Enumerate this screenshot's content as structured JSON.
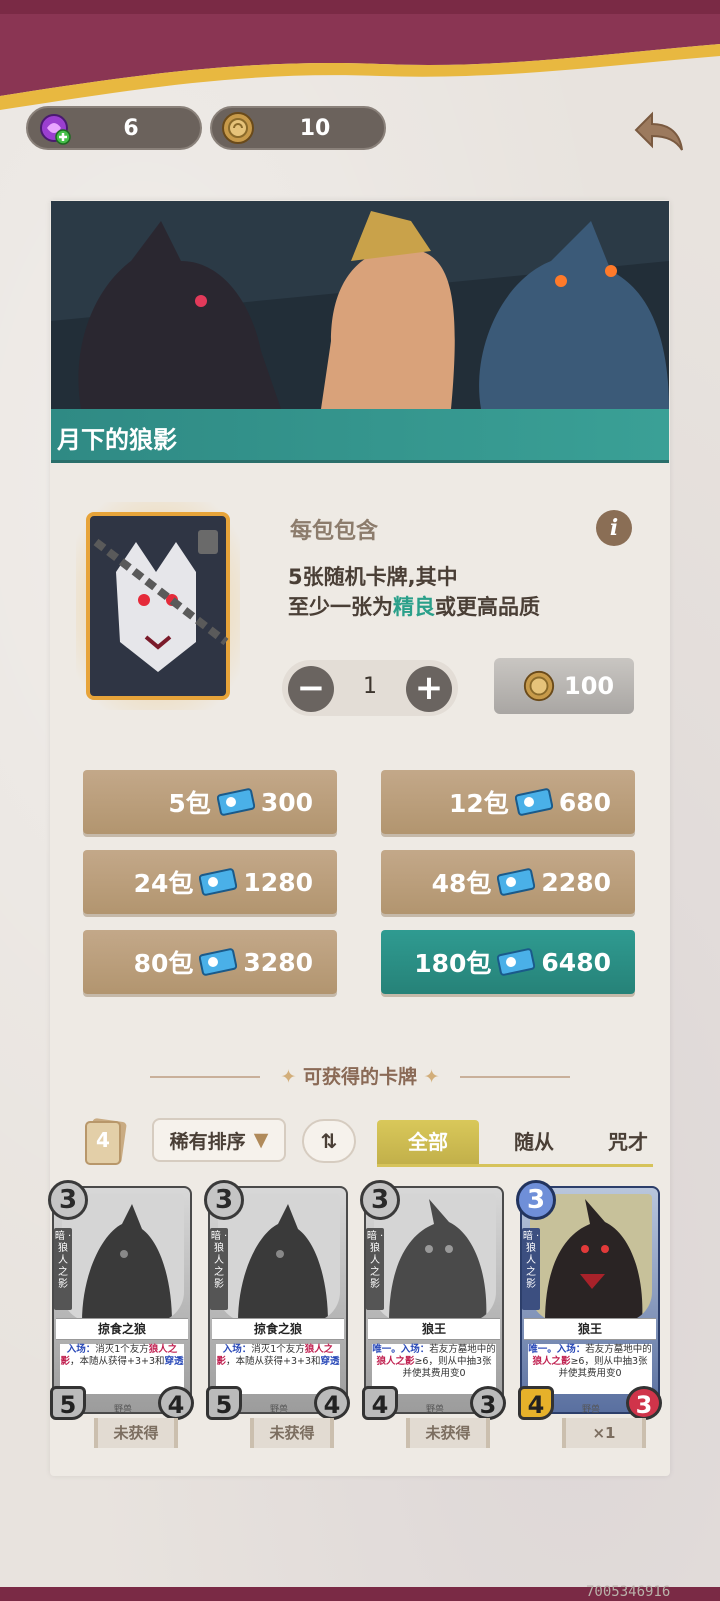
{
  "currency": {
    "essence": {
      "icon": "purple-candy-plus-icon",
      "value": "6"
    },
    "gold": {
      "icon": "gold-coin-icon",
      "value": "10"
    }
  },
  "header": {
    "back_icon": "back-arrow-icon"
  },
  "pack": {
    "title": "月下的狼影",
    "contains_label": "每包包含",
    "desc_line1": "5张随机卡牌,其中",
    "desc_line2_prefix": "至少一张为",
    "desc_line2_highlight": "精良",
    "desc_line2_suffix": "或更高品质",
    "quantity": "1",
    "price": "100"
  },
  "bulk_offers": [
    {
      "label": "5包",
      "price": "300",
      "highlight": false
    },
    {
      "label": "12包",
      "price": "680",
      "highlight": false
    },
    {
      "label": "24包",
      "price": "1280",
      "highlight": false
    },
    {
      "label": "48包",
      "price": "2280",
      "highlight": false
    },
    {
      "label": "80包",
      "price": "3280",
      "highlight": false
    },
    {
      "label": "180包",
      "price": "6480",
      "highlight": true
    }
  ],
  "cards_section": {
    "title": "可获得的卡牌",
    "count": "4",
    "sort_label": "稀有排序",
    "order_label": "⇅",
    "tabs": [
      "全部",
      "随从",
      "咒才"
    ]
  },
  "cards": [
    {
      "name": "掠食之狼",
      "cost": "3",
      "atk": "5",
      "hp": "4",
      "side": "暗 · 狼人之影",
      "tribe": "野兽",
      "status": "未获得",
      "text1": "入场：",
      "text2": "消灭1个友方",
      "kw": "狼人之影",
      "text3": "，本随从获得+3+3和",
      "kw2": "穿透"
    },
    {
      "name": "掠食之狼",
      "cost": "3",
      "atk": "5",
      "hp": "4",
      "side": "暗 · 狼人之影",
      "tribe": "野兽",
      "status": "未获得",
      "text1": "入场：",
      "text2": "消灭1个友方",
      "kw": "狼人之影",
      "text3": "，本随从获得+3+3和",
      "kw2": "穿透"
    },
    {
      "name": "狼王",
      "cost": "3",
      "atk": "4",
      "hp": "3",
      "side": "暗 · 狼人之影",
      "tribe": "野兽",
      "status": "未获得",
      "text1": "唯一。入场：",
      "text2": "若友方墓地中的",
      "kw": "狼人之影",
      "text3": "≥6，则从中抽3张并使其费用变0",
      "kw2": ""
    },
    {
      "name": "狼王",
      "cost": "3",
      "atk": "4",
      "hp": "3",
      "side": "暗 · 狼人之影",
      "tribe": "野兽",
      "status": "×1",
      "text1": "唯一。入场：",
      "text2": "若友方墓地中的",
      "kw": "狼人之影",
      "text3": "≥6，则从中抽3张并使其费用变0",
      "kw2": ""
    }
  ],
  "watermark": "7005346916"
}
